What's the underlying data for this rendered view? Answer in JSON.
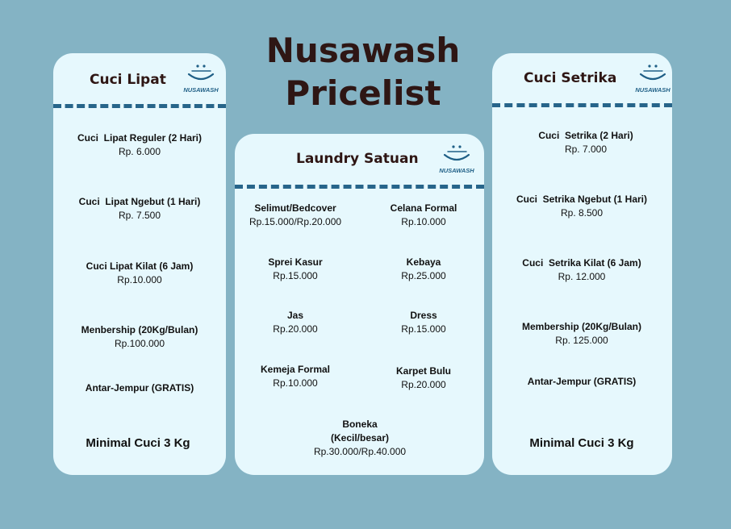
{
  "title": {
    "line1": "Nusawash",
    "line2": "Pricelist"
  },
  "brand": {
    "logo_text": "NUSAWASH",
    "logo_icon": "laundry-basket-icon",
    "colors": {
      "background": "#84b3c4",
      "card": "#e6f8fd",
      "divider": "#27658a",
      "title": "#2e1614",
      "logo": "#1f5f86"
    }
  },
  "cuci_lipat": {
    "title": "Cuci Lipat",
    "items": [
      {
        "name": "Cuci  Lipat Reguler (2 Hari)",
        "price": "Rp. 6.000"
      },
      {
        "name": "Cuci  Lipat Ngebut (1 Hari)",
        "price": "Rp. 7.500"
      },
      {
        "name": "Cuci Lipat Kilat (6 Jam)",
        "price": "Rp.10.000"
      },
      {
        "name": "Menbership (20Kg/Bulan)",
        "price": "Rp.100.000"
      },
      {
        "name": "Antar-Jempur (GRATIS)",
        "price": ""
      }
    ],
    "minimum": "Minimal Cuci 3 Kg"
  },
  "laundry_satuan": {
    "title": "Laundry Satuan",
    "left_items": [
      {
        "name": "Selimut/Bedcover",
        "price": "Rp.15.000/Rp.20.000"
      },
      {
        "name": "Sprei Kasur",
        "price": "Rp.15.000"
      },
      {
        "name": "Jas",
        "price": "Rp.20.000"
      },
      {
        "name": "Kemeja Formal",
        "price": "Rp.10.000"
      }
    ],
    "right_items": [
      {
        "name": "Celana Formal",
        "price": "Rp.10.000"
      },
      {
        "name": "Kebaya",
        "price": "Rp.25.000"
      },
      {
        "name": "Dress",
        "price": "Rp.15.000"
      },
      {
        "name": "Karpet Bulu",
        "price": "Rp.20.000"
      }
    ],
    "bottom_item": {
      "name": "Boneka\n(Kecil/besar)",
      "price": "Rp.30.000/Rp.40.000"
    }
  },
  "cuci_setrika": {
    "title": "Cuci Setrika",
    "items": [
      {
        "name": "Cuci  Setrika (2 Hari)",
        "price": "Rp. 7.000"
      },
      {
        "name": "Cuci  Setrika Ngebut (1 Hari)",
        "price": "Rp. 8.500"
      },
      {
        "name": "Cuci  Setrika Kilat (6 Jam)",
        "price": "Rp. 12.000"
      },
      {
        "name": "Membership (20Kg/Bulan)",
        "price": "Rp. 125.000"
      },
      {
        "name": "Antar-Jempur (GRATIS)",
        "price": ""
      }
    ],
    "minimum": "Minimal Cuci 3 Kg"
  }
}
